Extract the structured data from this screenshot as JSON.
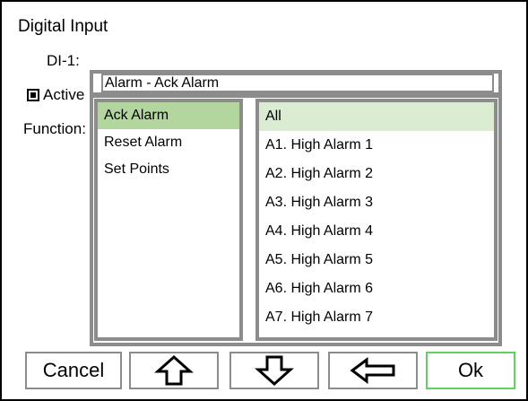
{
  "window": {
    "title": "Digital Input"
  },
  "form": {
    "di_label": "DI-1:",
    "active_label": "Active",
    "active_checked": true,
    "function_label": "Function:"
  },
  "selector": {
    "path_value": "Alarm - Ack Alarm",
    "categories": [
      {
        "label": "Ack Alarm",
        "selected": true
      },
      {
        "label": "Reset Alarm",
        "selected": false
      },
      {
        "label": "Set Points",
        "selected": false
      }
    ],
    "options": [
      {
        "label": "All",
        "selected": true
      },
      {
        "label": "A1. High Alarm 1",
        "selected": false
      },
      {
        "label": "A2. High Alarm 2",
        "selected": false
      },
      {
        "label": "A3. High Alarm 3",
        "selected": false
      },
      {
        "label": "A4. High Alarm 4",
        "selected": false
      },
      {
        "label": "A5. High Alarm 5",
        "selected": false
      },
      {
        "label": "A6. High Alarm 6",
        "selected": false
      },
      {
        "label": "A7. High Alarm 7",
        "selected": false
      }
    ]
  },
  "buttons": {
    "cancel_label": "Cancel",
    "up_icon": "arrow-up-icon",
    "down_icon": "arrow-down-icon",
    "back_icon": "arrow-left-icon",
    "ok_label": "Ok"
  },
  "colors": {
    "selected_category": "#b3d69f",
    "selected_option": "#daecd1",
    "ok_border": "#5dd35d",
    "panel_border": "#8c8c8c"
  }
}
